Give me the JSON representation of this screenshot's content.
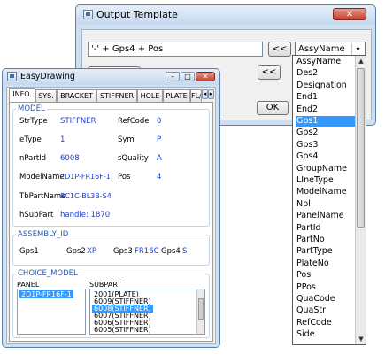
{
  "output_template": {
    "title": "Output Template",
    "close_glyph": "✕",
    "expression_value": "'-' + Gps4 + Pos",
    "add_button_1": "<<",
    "add_button_2": "<<",
    "ok_button": "OK",
    "combo_value": "AssyName",
    "combo_arrow": "▾",
    "dropdown_items": [
      "AssyName",
      "Des2",
      "Designation",
      "End1",
      "End2",
      "Gps1",
      "Gps2",
      "Gps3",
      "Gps4",
      "GroupName",
      "LIneType",
      "ModelName",
      "Npl",
      "PanelName",
      "PartId",
      "PartNo",
      "PartType",
      "PlateNo",
      "Pos",
      "PPos",
      "QuaCode",
      "QuaStr",
      "RefCode",
      "Side"
    ],
    "selected_item": "Gps1",
    "scroll_up": "▲",
    "scroll_down": "▼"
  },
  "easydrawing": {
    "title": "EasyDrawing",
    "caption_buttons": {
      "minimize": "–",
      "maximize": "□",
      "close": "✕"
    },
    "tabs": [
      "INFO.",
      "SYS.",
      "BRACKET",
      "STIFFNER",
      "HOLE",
      "PLATE",
      "FL/"
    ],
    "tab_scroll": {
      "left": "◂",
      "right": "▸"
    },
    "model": {
      "label": "MODEL",
      "rows": [
        {
          "k1": "StrType",
          "v1": "STIFFNER",
          "k2": "RefCode",
          "v2": "0"
        },
        {
          "k1": "eType",
          "v1": "1",
          "k2": "Sym",
          "v2": "P"
        },
        {
          "k1": "nPartId",
          "v1": "6008",
          "k2": "sQuality",
          "v2": "A"
        },
        {
          "k1": "ModelName",
          "v1": "2D1P-FR16F-1",
          "k2": "Pos",
          "v2": "4"
        }
      ],
      "tbpart": {
        "k": "TbPartName",
        "v": "BC1C-BL3B-S4"
      },
      "hsubpart": {
        "k": "hSubPart",
        "v": "handle: 1870"
      }
    },
    "assembly": {
      "label": "ASSEMBLY_ID",
      "items": [
        {
          "k": "Gps1",
          "v": ""
        },
        {
          "k": "Gps2",
          "v": "XP"
        },
        {
          "k": "Gps3",
          "v": "FR16C"
        },
        {
          "k": "Gps4",
          "v": "S"
        }
      ]
    },
    "choice": {
      "label": "CHOICE_MODEL",
      "panel_header": "PANEL",
      "subpart_header": "SUBPART",
      "panel_items": [
        "2D1P-FR16F-1"
      ],
      "subpart_items": [
        "2001(PLATE)",
        "6009(STIFFNER)",
        "6008(STIFFNER)",
        "6007(STIFFNER)",
        "6006(STIFFNER)",
        "6005(STIFFNER)"
      ],
      "subpart_selected": "6008(STIFFNER)"
    }
  },
  "colors": {
    "selection": "#3399ff",
    "value_text": "#1a3ccf",
    "group_label": "#2f5aa8"
  }
}
